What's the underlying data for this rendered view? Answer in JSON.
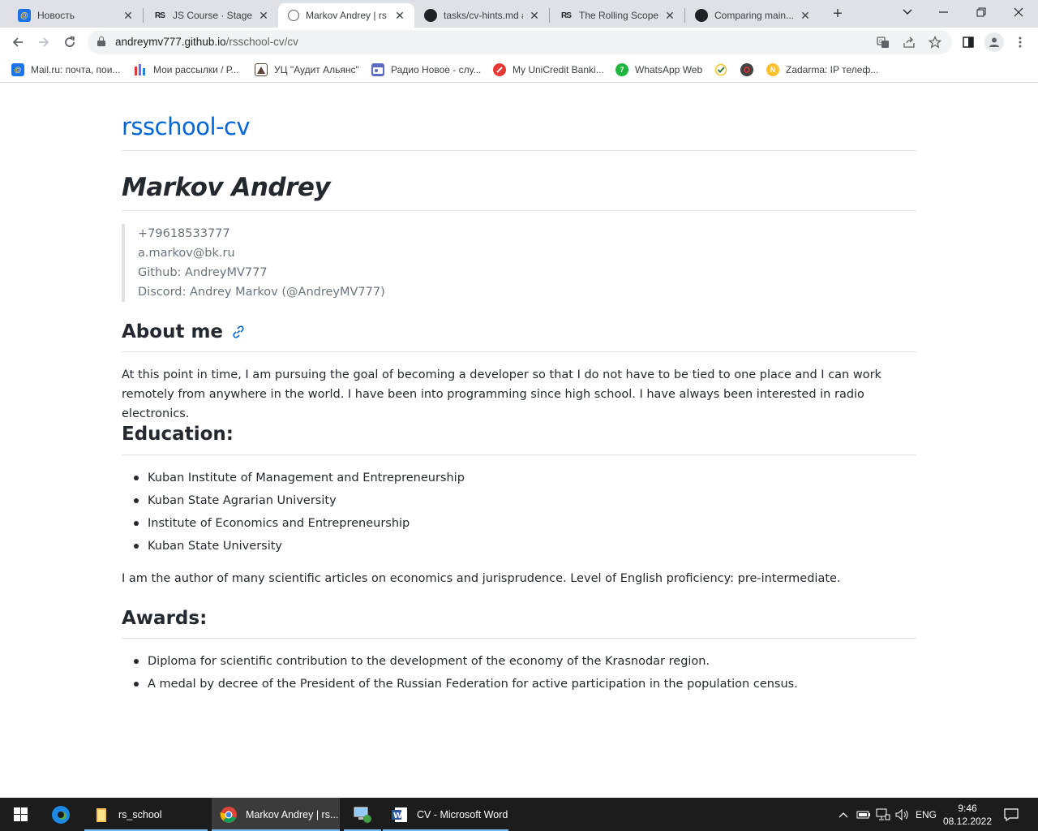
{
  "browser": {
    "tabs": [
      {
        "title": "Новость",
        "icon": "mail-icon",
        "active": false
      },
      {
        "title": "JS Course · Stage 0 ·",
        "icon": "rs-icon",
        "active": false
      },
      {
        "title": "Markov Andrey | rs",
        "icon": "globe-icon",
        "active": true
      },
      {
        "title": "tasks/cv-hints.md a",
        "icon": "github-icon",
        "active": false
      },
      {
        "title": "The Rolling Scopes",
        "icon": "rs-icon",
        "active": false
      },
      {
        "title": "Comparing main...",
        "icon": "github-icon",
        "active": false
      }
    ],
    "new_tab": "+",
    "url_host": "andreymv777.github.io",
    "url_path": "/rsschool-cv/cv",
    "bookmarks": [
      {
        "label": "Mail.ru: почта, пои...",
        "color": "#1a73e8"
      },
      {
        "label": "Мои рассылки / Р...",
        "color": "#7b61ff"
      },
      {
        "label": "УЦ \"Аудит Альянс\"",
        "color": "#8d6e63"
      },
      {
        "label": "Радио Новое - слу...",
        "color": "#5c6bc0"
      },
      {
        "label": "My UniCredit Banki...",
        "color": "#e53935"
      },
      {
        "label": "WhatsApp Web",
        "color": "#1db53b"
      },
      {
        "label": "",
        "color": "#2e7d32"
      },
      {
        "label": "",
        "color": "#424242"
      },
      {
        "label": "Zadarma: IP телеф...",
        "color": "#fbc02d"
      }
    ]
  },
  "page": {
    "site_title": "rsschool-cv",
    "name": "Markov Andrey",
    "contacts": [
      "+79618533777",
      "a.markov@bk.ru",
      "Github: AndreyMV777",
      "Discord: Andrey Markov (@AndreyMV777)"
    ],
    "about_heading": "About me",
    "about_text": "At this point in time, I am pursuing the goal of becoming a developer so that I do not have to be tied to one place and I can work remotely from anywhere in the world. I have been into programming since high school. I have always been interested in radio electronics.",
    "education_heading": "Education:",
    "education": [
      "Kuban Institute of Management and Entrepreneurship",
      "Kuban State Agrarian University",
      "Institute of Economics and Entrepreneurship",
      "Kuban State University"
    ],
    "education_note": "I am the author of many scientific articles on economics and jurisprudence. Level of English proficiency: pre-intermediate.",
    "awards_heading": "Awards:",
    "awards": [
      "Diploma for scientific contribution to the development of the economy of the Krasnodar region.",
      "A medal by decree of the President of the Russian Federation for active participation in the population census."
    ],
    "link_color": "#0366d6"
  },
  "taskbar": {
    "apps": [
      {
        "label": "rs_school",
        "icon": "folder-icon"
      },
      {
        "label": "Markov Andrey | rs...",
        "icon": "chrome-icon"
      },
      {
        "label": "",
        "icon": "network-computer-icon"
      },
      {
        "label": "CV - Microsoft Word",
        "icon": "word-icon"
      }
    ],
    "language": "ENG",
    "time": "9:46",
    "date": "08.12.2022"
  }
}
